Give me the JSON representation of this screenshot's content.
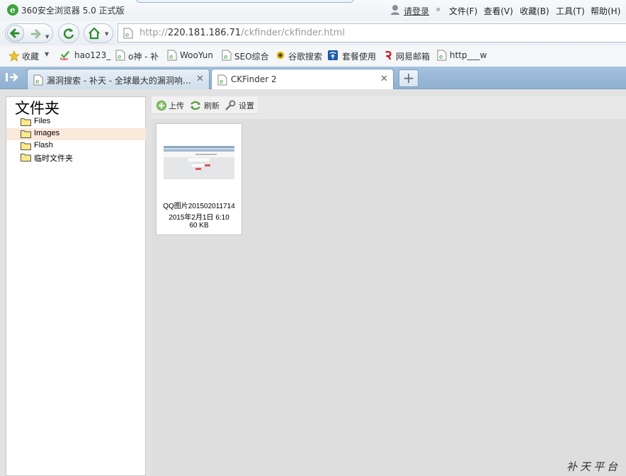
{
  "browser": {
    "title": "360安全浏览器 5.0 正式版",
    "login": "请登录",
    "menus": [
      "文件(F)",
      "查看(V)",
      "收藏(B)",
      "工具(T)",
      "帮助(H)"
    ]
  },
  "address": {
    "scheme": "http://",
    "host": "220.181.186.71",
    "path": "/ckfinder/ckfinder.html"
  },
  "bookmarks": {
    "favorites_label": "收藏",
    "items": [
      "hao123_",
      "o神 - 补",
      "WooYun",
      "SEO综合",
      "谷歌搜索",
      "套餐使用",
      "网易邮箱",
      "http___w"
    ]
  },
  "tabs": [
    {
      "label": "漏洞搜索 - 补天 - 全球最大的漏洞响…"
    },
    {
      "label": "CKFinder 2"
    }
  ],
  "tab_close_glyph": "✕",
  "newtab_glyph": "+",
  "ckfinder": {
    "folders_title": "文件夹",
    "folders": [
      {
        "name": "Files",
        "selected": false
      },
      {
        "name": "Images",
        "selected": true
      },
      {
        "name": "Flash",
        "selected": false
      },
      {
        "name": "临时文件夹",
        "selected": false
      }
    ],
    "toolbar": {
      "upload": "上传",
      "refresh": "刷新",
      "settings": "设置"
    },
    "files": [
      {
        "name": "QQ图片201502011714",
        "date": "2015年2月1日 6:10",
        "size": "60 KB"
      }
    ]
  },
  "watermark": "补天平台"
}
